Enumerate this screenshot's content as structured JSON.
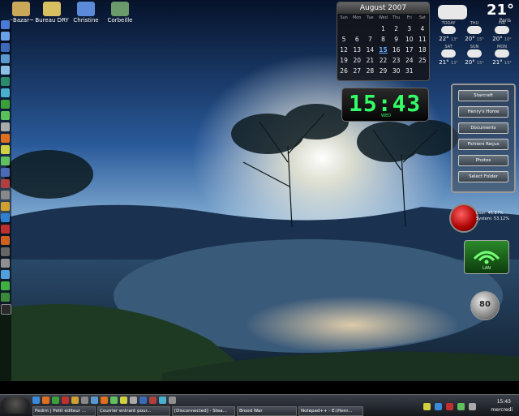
{
  "desktop": {
    "icons": [
      {
        "label": "~Bazar~",
        "color": "#c9a85a"
      },
      {
        "label": "Bureau DRY",
        "color": "#d8c060"
      },
      {
        "label": "Christine",
        "color": "#5a8ad8"
      },
      {
        "label": "Corbeille",
        "color": "#6a9a6a"
      }
    ]
  },
  "calendar": {
    "month": "August 2007",
    "days_header": [
      "Sun",
      "Mon",
      "Tue",
      "Wed",
      "Thu",
      "Fri",
      "Sat"
    ],
    "dates": [
      "",
      "",
      "",
      "1",
      "2",
      "3",
      "4",
      "5",
      "6",
      "7",
      "8",
      "9",
      "10",
      "11",
      "12",
      "13",
      "14",
      "15",
      "16",
      "17",
      "18",
      "19",
      "20",
      "21",
      "22",
      "23",
      "24",
      "25",
      "26",
      "27",
      "28",
      "29",
      "30",
      "31",
      ""
    ],
    "today": "15"
  },
  "weather": {
    "temp": "21°",
    "city": "Paris",
    "forecast": [
      {
        "day": "TODAY",
        "hi": "22°",
        "lo": "13°"
      },
      {
        "day": "THU",
        "hi": "20°",
        "lo": "15°"
      },
      {
        "day": "FRI",
        "hi": "20°",
        "lo": "10°"
      },
      {
        "day": "SAT",
        "hi": "21°",
        "lo": "13°"
      },
      {
        "day": "SUN",
        "hi": "20°",
        "lo": "15°"
      },
      {
        "day": "MON",
        "hi": "21°",
        "lo": "13°"
      }
    ]
  },
  "clock": {
    "time": "15:43",
    "sub": "WED"
  },
  "launcher": {
    "buttons": [
      "Starcraft",
      "Henry's Home",
      "Documents",
      "Fichiers Reçus",
      "Photos",
      "Select Folder"
    ]
  },
  "cpu": {
    "user": "User: 46.87%",
    "system": "System: 53.12%"
  },
  "lan": {
    "label": "LAN"
  },
  "volume": {
    "value": "80"
  },
  "taskbar": {
    "tasks": [
      "Pedim | Petit éditeur ...",
      "Courrier entrant pour...",
      "[Disconnected] - Stea...",
      "Brood War",
      "Notepad++ - E:\\Henr..."
    ],
    "time": "15:43",
    "day": "mercredi"
  },
  "colors": {
    "accent": "#33ff66",
    "sky": "#2a5a9a",
    "water": "#1a3a5a"
  }
}
